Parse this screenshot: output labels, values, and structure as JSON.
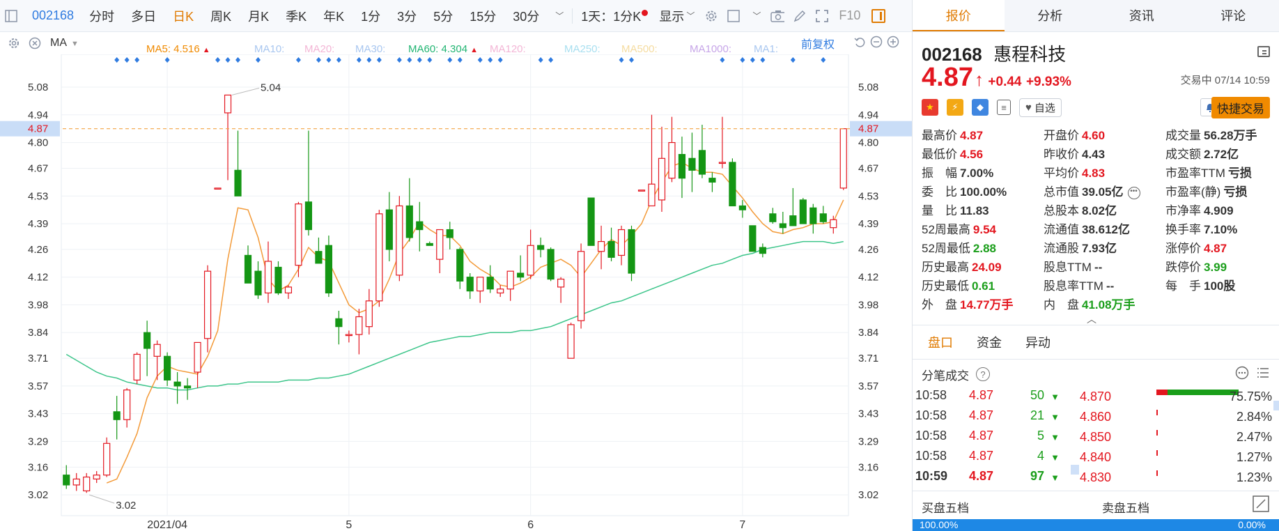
{
  "toolbar": {
    "code": "002168",
    "periods": [
      "分时",
      "多日",
      "日K",
      "周K",
      "月K",
      "季K",
      "年K",
      "1分",
      "3分",
      "5分",
      "15分",
      "30分"
    ],
    "active_period": "日K",
    "multi_chart": "1天：1分K",
    "display": "显示",
    "f10": "F10"
  },
  "ma_legend": {
    "label": "MA",
    "items": [
      {
        "text": "MA5: 4.516",
        "color": "#f08a00",
        "up": true
      },
      {
        "text": "MA10:",
        "color": "#a9c7f0",
        "up": false
      },
      {
        "text": "MA20:",
        "color": "#f3b6d6",
        "up": false
      },
      {
        "text": "MA30:",
        "color": "#a9c7f0",
        "up": false
      },
      {
        "text": "MA60: 4.304",
        "color": "#22b573",
        "up": true
      },
      {
        "text": "MA120:",
        "color": "#f3b6d6",
        "up": false
      },
      {
        "text": "MA250:",
        "color": "#a8dff0",
        "up": false
      },
      {
        "text": "MA500:",
        "color": "#f5dca0",
        "up": false
      },
      {
        "text": "MA1000:",
        "color": "#c7a6e8",
        "up": false
      },
      {
        "text": "MA1:",
        "color": "#a9c7f0",
        "up": false
      }
    ],
    "adjust": "前复权"
  },
  "chart_data": {
    "type": "candlestick",
    "ylim": [
      2.95,
      5.14
    ],
    "yticks": [
      "5.08",
      "4.94",
      "4.80",
      "4.67",
      "4.53",
      "4.39",
      "4.26",
      "4.12",
      "3.98",
      "3.84",
      "3.71",
      "3.57",
      "3.43",
      "3.29",
      "3.16",
      "3.02"
    ],
    "current_price": "4.87",
    "x_labels": [
      {
        "label": "2021/04",
        "index": 10
      },
      {
        "label": "5",
        "index": 28
      },
      {
        "label": "6",
        "index": 46
      },
      {
        "label": "7",
        "index": 67
      }
    ],
    "high_annotation": {
      "label": "5.04",
      "value": 5.04,
      "index": 16
    },
    "low_annotation": {
      "label": "3.02",
      "value": 3.02,
      "index": 2
    },
    "event_markers": [
      5,
      6,
      7,
      10,
      15,
      16,
      17,
      19,
      23,
      25,
      26,
      27,
      29,
      30,
      31,
      33,
      34,
      35,
      36,
      38,
      39,
      41,
      42,
      43,
      47,
      48,
      55,
      56,
      65,
      67,
      68,
      69,
      72,
      75
    ],
    "candles": [
      {
        "o": 3.12,
        "h": 3.17,
        "l": 3.05,
        "c": 3.07
      },
      {
        "o": 3.07,
        "h": 3.13,
        "l": 3.04,
        "c": 3.1
      },
      {
        "o": 3.04,
        "h": 3.13,
        "l": 3.03,
        "c": 3.11
      },
      {
        "o": 3.1,
        "h": 3.14,
        "l": 3.08,
        "c": 3.12
      },
      {
        "o": 3.12,
        "h": 3.31,
        "l": 3.11,
        "c": 3.28
      },
      {
        "o": 3.44,
        "h": 3.52,
        "l": 3.3,
        "c": 3.4
      },
      {
        "o": 3.4,
        "h": 3.56,
        "l": 3.36,
        "c": 3.55
      },
      {
        "o": 3.6,
        "h": 3.74,
        "l": 3.58,
        "c": 3.73
      },
      {
        "o": 3.84,
        "h": 3.9,
        "l": 3.62,
        "c": 3.76
      },
      {
        "o": 3.72,
        "h": 3.8,
        "l": 3.6,
        "c": 3.78
      },
      {
        "o": 3.72,
        "h": 3.74,
        "l": 3.57,
        "c": 3.6
      },
      {
        "o": 3.59,
        "h": 3.64,
        "l": 3.48,
        "c": 3.57
      },
      {
        "o": 3.57,
        "h": 3.61,
        "l": 3.5,
        "c": 3.56
      },
      {
        "o": 3.64,
        "h": 3.78,
        "l": 3.56,
        "c": 3.79
      },
      {
        "o": 3.81,
        "h": 4.18,
        "l": 3.74,
        "c": 4.15
      },
      {
        "o": 4.57,
        "h": 4.57,
        "l": 4.57,
        "c": 4.57
      },
      {
        "o": 4.95,
        "h": 5.04,
        "l": 4.61,
        "c": 5.04
      },
      {
        "o": 4.66,
        "h": 4.86,
        "l": 4.53,
        "c": 4.53
      },
      {
        "o": 4.23,
        "h": 4.28,
        "l": 4.09,
        "c": 4.09
      },
      {
        "o": 4.15,
        "h": 4.2,
        "l": 4.01,
        "c": 4.03
      },
      {
        "o": 4.04,
        "h": 4.3,
        "l": 3.99,
        "c": 4.2
      },
      {
        "o": 4.17,
        "h": 4.2,
        "l": 4.03,
        "c": 4.04
      },
      {
        "o": 4.04,
        "h": 4.08,
        "l": 4.01,
        "c": 4.07
      },
      {
        "o": 4.18,
        "h": 4.5,
        "l": 4.12,
        "c": 4.49
      },
      {
        "o": 4.5,
        "h": 4.86,
        "l": 4.33,
        "c": 4.36
      },
      {
        "o": 4.25,
        "h": 4.32,
        "l": 4.2,
        "c": 4.19
      },
      {
        "o": 4.28,
        "h": 4.33,
        "l": 4.02,
        "c": 4.04
      },
      {
        "o": 3.91,
        "h": 3.95,
        "l": 3.78,
        "c": 3.87
      },
      {
        "o": 3.83,
        "h": 3.85,
        "l": 3.79,
        "c": 3.83
      },
      {
        "o": 3.83,
        "h": 3.96,
        "l": 3.73,
        "c": 3.92
      },
      {
        "o": 3.87,
        "h": 4.06,
        "l": 3.83,
        "c": 4.0
      },
      {
        "o": 4.0,
        "h": 4.46,
        "l": 3.97,
        "c": 4.44
      },
      {
        "o": 4.46,
        "h": 4.55,
        "l": 4.2,
        "c": 4.26
      },
      {
        "o": 4.13,
        "h": 4.53,
        "l": 4.1,
        "c": 4.48
      },
      {
        "o": 4.48,
        "h": 4.62,
        "l": 4.3,
        "c": 4.32
      },
      {
        "o": 4.4,
        "h": 4.5,
        "l": 4.25,
        "c": 4.36
      },
      {
        "o": 4.29,
        "h": 4.3,
        "l": 4.28,
        "c": 4.28
      },
      {
        "o": 4.21,
        "h": 4.36,
        "l": 4.14,
        "c": 4.36
      },
      {
        "o": 4.36,
        "h": 4.4,
        "l": 4.26,
        "c": 4.32
      },
      {
        "o": 4.26,
        "h": 4.27,
        "l": 4.06,
        "c": 4.1
      },
      {
        "o": 4.12,
        "h": 4.14,
        "l": 4.01,
        "c": 4.05
      },
      {
        "o": 4.05,
        "h": 4.1,
        "l": 3.99,
        "c": 4.12
      },
      {
        "o": 4.12,
        "h": 4.18,
        "l": 4.04,
        "c": 4.06
      },
      {
        "o": 4.04,
        "h": 4.08,
        "l": 4.02,
        "c": 4.06
      },
      {
        "o": 4.06,
        "h": 4.12,
        "l": 4.0,
        "c": 4.15
      },
      {
        "o": 4.14,
        "h": 4.23,
        "l": 4.1,
        "c": 4.12
      },
      {
        "o": 4.13,
        "h": 4.36,
        "l": 4.11,
        "c": 4.28
      },
      {
        "o": 4.28,
        "h": 4.32,
        "l": 4.22,
        "c": 4.26
      },
      {
        "o": 4.26,
        "h": 4.27,
        "l": 4.1,
        "c": 4.11
      },
      {
        "o": 4.07,
        "h": 4.12,
        "l": 3.99,
        "c": 4.11
      },
      {
        "o": 3.71,
        "h": 3.89,
        "l": 3.71,
        "c": 3.88
      },
      {
        "o": 3.9,
        "h": 4.29,
        "l": 3.86,
        "c": 4.25
      },
      {
        "o": 4.52,
        "h": 4.52,
        "l": 4.28,
        "c": 4.28
      },
      {
        "o": 4.25,
        "h": 4.38,
        "l": 4.16,
        "c": 4.3
      },
      {
        "o": 4.3,
        "h": 4.37,
        "l": 4.2,
        "c": 4.22
      },
      {
        "o": 4.23,
        "h": 4.38,
        "l": 4.18,
        "c": 4.36
      },
      {
        "o": 4.36,
        "h": 4.38,
        "l": 4.1,
        "c": 4.14
      },
      {
        "o": 4.56,
        "h": 4.56,
        "l": 4.56,
        "c": 4.56
      },
      {
        "o": 4.48,
        "h": 4.94,
        "l": 4.48,
        "c": 4.59
      },
      {
        "o": 4.51,
        "h": 4.88,
        "l": 4.45,
        "c": 4.72
      },
      {
        "o": 4.62,
        "h": 4.93,
        "l": 4.6,
        "c": 4.8
      },
      {
        "o": 4.74,
        "h": 4.83,
        "l": 4.52,
        "c": 4.62
      },
      {
        "o": 4.72,
        "h": 4.85,
        "l": 4.55,
        "c": 4.66
      },
      {
        "o": 4.76,
        "h": 4.89,
        "l": 4.62,
        "c": 4.64
      },
      {
        "o": 4.62,
        "h": 4.65,
        "l": 4.55,
        "c": 4.6
      },
      {
        "o": 4.7,
        "h": 4.93,
        "l": 4.67,
        "c": 4.7
      },
      {
        "o": 4.7,
        "h": 4.72,
        "l": 4.48,
        "c": 4.48
      },
      {
        "o": 4.48,
        "h": 4.51,
        "l": 4.42,
        "c": 4.46
      },
      {
        "o": 4.38,
        "h": 4.38,
        "l": 4.25,
        "c": 4.25
      },
      {
        "o": 4.27,
        "h": 4.29,
        "l": 4.22,
        "c": 4.24
      },
      {
        "o": 4.44,
        "h": 4.47,
        "l": 4.39,
        "c": 4.4
      },
      {
        "o": 4.39,
        "h": 4.45,
        "l": 4.34,
        "c": 4.37
      },
      {
        "o": 4.43,
        "h": 4.57,
        "l": 4.38,
        "c": 4.38
      },
      {
        "o": 4.51,
        "h": 4.52,
        "l": 4.39,
        "c": 4.39
      },
      {
        "o": 4.47,
        "h": 4.49,
        "l": 4.34,
        "c": 4.39
      },
      {
        "o": 4.44,
        "h": 4.48,
        "l": 4.39,
        "c": 4.4
      },
      {
        "o": 4.37,
        "h": 4.43,
        "l": 4.34,
        "c": 4.41
      },
      {
        "o": 4.57,
        "h": 4.87,
        "l": 4.56,
        "c": 4.87
      }
    ],
    "ma5": [
      null,
      null,
      null,
      null,
      3.08,
      3.1,
      3.21,
      3.33,
      3.51,
      3.62,
      3.67,
      3.65,
      3.64,
      3.63,
      3.72,
      3.85,
      4.21,
      4.47,
      4.46,
      4.32,
      4.11,
      4.05,
      4.08,
      4.16,
      4.27,
      4.22,
      4.2,
      4.09,
      3.98,
      3.94,
      3.96,
      4.0,
      4.11,
      4.24,
      4.31,
      4.4,
      4.36,
      4.33,
      4.33,
      4.28,
      4.2,
      4.16,
      4.13,
      4.08,
      4.07,
      4.09,
      4.12,
      4.17,
      4.19,
      4.21,
      4.18,
      4.12,
      4.19,
      4.26,
      4.31,
      4.28,
      4.33,
      4.39,
      4.51,
      4.6,
      4.68,
      4.7,
      4.67,
      4.65,
      4.65,
      4.64,
      4.58,
      4.52,
      4.45,
      4.39,
      4.35,
      4.34,
      4.36,
      4.37,
      4.39,
      4.39,
      4.4,
      4.51
    ],
    "ma60": [
      3.73,
      3.7,
      3.67,
      3.64,
      3.62,
      3.61,
      3.59,
      3.58,
      3.57,
      3.56,
      3.56,
      3.55,
      3.55,
      3.56,
      3.57,
      3.57,
      3.58,
      3.58,
      3.59,
      3.59,
      3.59,
      3.59,
      3.6,
      3.6,
      3.6,
      3.61,
      3.61,
      3.62,
      3.63,
      3.65,
      3.67,
      3.69,
      3.71,
      3.73,
      3.75,
      3.77,
      3.79,
      3.8,
      3.81,
      3.82,
      3.82,
      3.83,
      3.84,
      3.84,
      3.84,
      3.85,
      3.85,
      3.86,
      3.87,
      3.89,
      3.91,
      3.93,
      3.95,
      3.97,
      3.99,
      4.0,
      4.02,
      4.04,
      4.06,
      4.08,
      4.1,
      4.12,
      4.14,
      4.16,
      4.18,
      4.19,
      4.21,
      4.23,
      4.24,
      4.26,
      4.27,
      4.28,
      4.29,
      4.3,
      4.3,
      4.3,
      4.29,
      4.3
    ]
  },
  "right": {
    "tabs": [
      "报价",
      "分析",
      "资讯",
      "评论"
    ],
    "active_tab": "报价",
    "code": "002168",
    "name": "惠程科技",
    "price": "4.87",
    "arrow": "↑",
    "change": "+0.44",
    "change_pct": "+9.93%",
    "status": "交易中 07/14 10:59",
    "fav": "自选",
    "quick_trade": "快捷交易",
    "quote": [
      [
        {
          "l": "最高价",
          "v": "4.87",
          "c": "red"
        },
        {
          "l": "开盘价",
          "v": "4.60",
          "c": "red"
        },
        {
          "l": "成交量",
          "v": "56.28万手",
          "c": "dark"
        }
      ],
      [
        {
          "l": "最低价",
          "v": "4.56",
          "c": "red"
        },
        {
          "l": "昨收价",
          "v": "4.43",
          "c": "dark"
        },
        {
          "l": "成交额",
          "v": "2.72亿",
          "c": "dark"
        }
      ],
      [
        {
          "l": "振　幅",
          "v": "7.00%",
          "c": "dark"
        },
        {
          "l": "平均价",
          "v": "4.83",
          "c": "red"
        },
        {
          "l": "市盈率TTM",
          "v": "亏损",
          "c": "dark"
        }
      ],
      [
        {
          "l": "委　比",
          "v": "100.00%",
          "c": "dark"
        },
        {
          "l": "总市值",
          "v": "39.05亿",
          "c": "dark"
        },
        {
          "l": "市盈率(静)",
          "v": "亏损",
          "c": "dark"
        }
      ],
      [
        {
          "l": "量　比",
          "v": "11.83",
          "c": "dark"
        },
        {
          "l": "总股本",
          "v": "8.02亿",
          "c": "dark"
        },
        {
          "l": "市净率",
          "v": "4.909",
          "c": "dark"
        }
      ],
      [
        {
          "l": "52周最高",
          "v": "9.54",
          "c": "red"
        },
        {
          "l": "流通值",
          "v": "38.612亿",
          "c": "dark"
        },
        {
          "l": "换手率",
          "v": "7.10%",
          "c": "dark"
        }
      ],
      [
        {
          "l": "52周最低",
          "v": "2.88",
          "c": "green"
        },
        {
          "l": "流通股",
          "v": "7.93亿",
          "c": "dark"
        },
        {
          "l": "涨停价",
          "v": "4.87",
          "c": "red"
        }
      ],
      [
        {
          "l": "历史最高",
          "v": "24.09",
          "c": "red"
        },
        {
          "l": "股息TTM",
          "v": "--",
          "c": "dark"
        },
        {
          "l": "跌停价",
          "v": "3.99",
          "c": "green"
        }
      ],
      [
        {
          "l": "历史最低",
          "v": "0.61",
          "c": "green"
        },
        {
          "l": "股息率TTM",
          "v": "--",
          "c": "dark"
        },
        {
          "l": "每　手",
          "v": "100股",
          "c": "dark"
        }
      ],
      [
        {
          "l": "外　盘",
          "v": "14.77万手",
          "c": "red"
        },
        {
          "l": "内　盘",
          "v": "41.08万手",
          "c": "green"
        },
        null
      ]
    ],
    "sub_tabs": [
      "盘口",
      "资金",
      "异动"
    ],
    "active_sub_tab": "盘口",
    "fb_title": "分笔成交",
    "trades": [
      {
        "t": "10:58",
        "p": "4.87",
        "v": "50",
        "bold": false
      },
      {
        "t": "10:58",
        "p": "4.87",
        "v": "21",
        "bold": false
      },
      {
        "t": "10:58",
        "p": "4.87",
        "v": "5",
        "bold": false
      },
      {
        "t": "10:58",
        "p": "4.87",
        "v": "4",
        "bold": false
      },
      {
        "t": "10:59",
        "p": "4.87",
        "v": "97",
        "bold": true
      }
    ],
    "levels": [
      {
        "price": "4.870",
        "pct": "75.75%",
        "share": 0.7575
      },
      {
        "price": "4.860",
        "pct": "2.84%",
        "share": 0.0284
      },
      {
        "price": "4.850",
        "pct": "2.47%",
        "share": 0.0247
      },
      {
        "price": "4.840",
        "pct": "1.27%",
        "share": 0.0127
      },
      {
        "price": "4.830",
        "pct": "1.23%",
        "share": 0.0123
      }
    ],
    "buy5": "买盘五档",
    "sell5": "卖盘五档",
    "buy_pct": "100.00%",
    "sell_pct": "0.00%"
  },
  "colors": {
    "up": "#e3161f",
    "down": "#149614",
    "ma5": "#f39a38",
    "ma60": "#3cc58a",
    "accent": "#e07a00",
    "link": "#2f7be0"
  }
}
